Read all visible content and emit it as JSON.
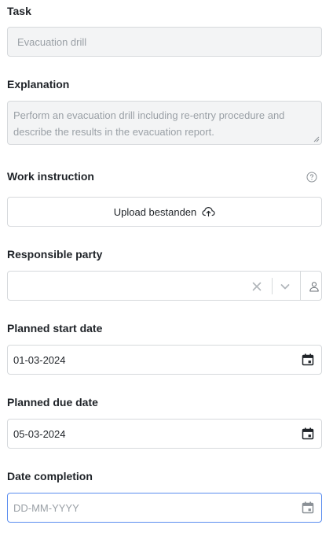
{
  "task": {
    "label": "Task",
    "placeholder": "Evacuation drill"
  },
  "explanation": {
    "label": "Explanation",
    "placeholder": "Perform an evacuation drill including re-entry procedure and describe the results in the evacuation report."
  },
  "work_instruction": {
    "label": "Work instruction",
    "upload_label": "Upload bestanden",
    "help_icon": "question-circle-icon",
    "upload_icon": "cloud-upload-icon"
  },
  "responsible_party": {
    "label": "Responsible party",
    "value": "",
    "clear_icon": "close-icon",
    "dropdown_icon": "chevron-down-icon",
    "user_icon": "person-icon"
  },
  "planned_start_date": {
    "label": "Planned start date",
    "value": "01-03-2024",
    "icon": "calendar-icon"
  },
  "planned_due_date": {
    "label": "Planned due date",
    "value": "05-03-2024",
    "icon": "calendar-icon"
  },
  "date_completion": {
    "label": "Date completion",
    "placeholder": "DD-MM-YYYY",
    "icon": "calendar-icon"
  },
  "colors": {
    "text": "#1f2328",
    "muted": "#9aa0a6",
    "border": "#d6d9dc",
    "focus_border": "#5b8def",
    "disabled_bg": "#f3f4f5"
  }
}
